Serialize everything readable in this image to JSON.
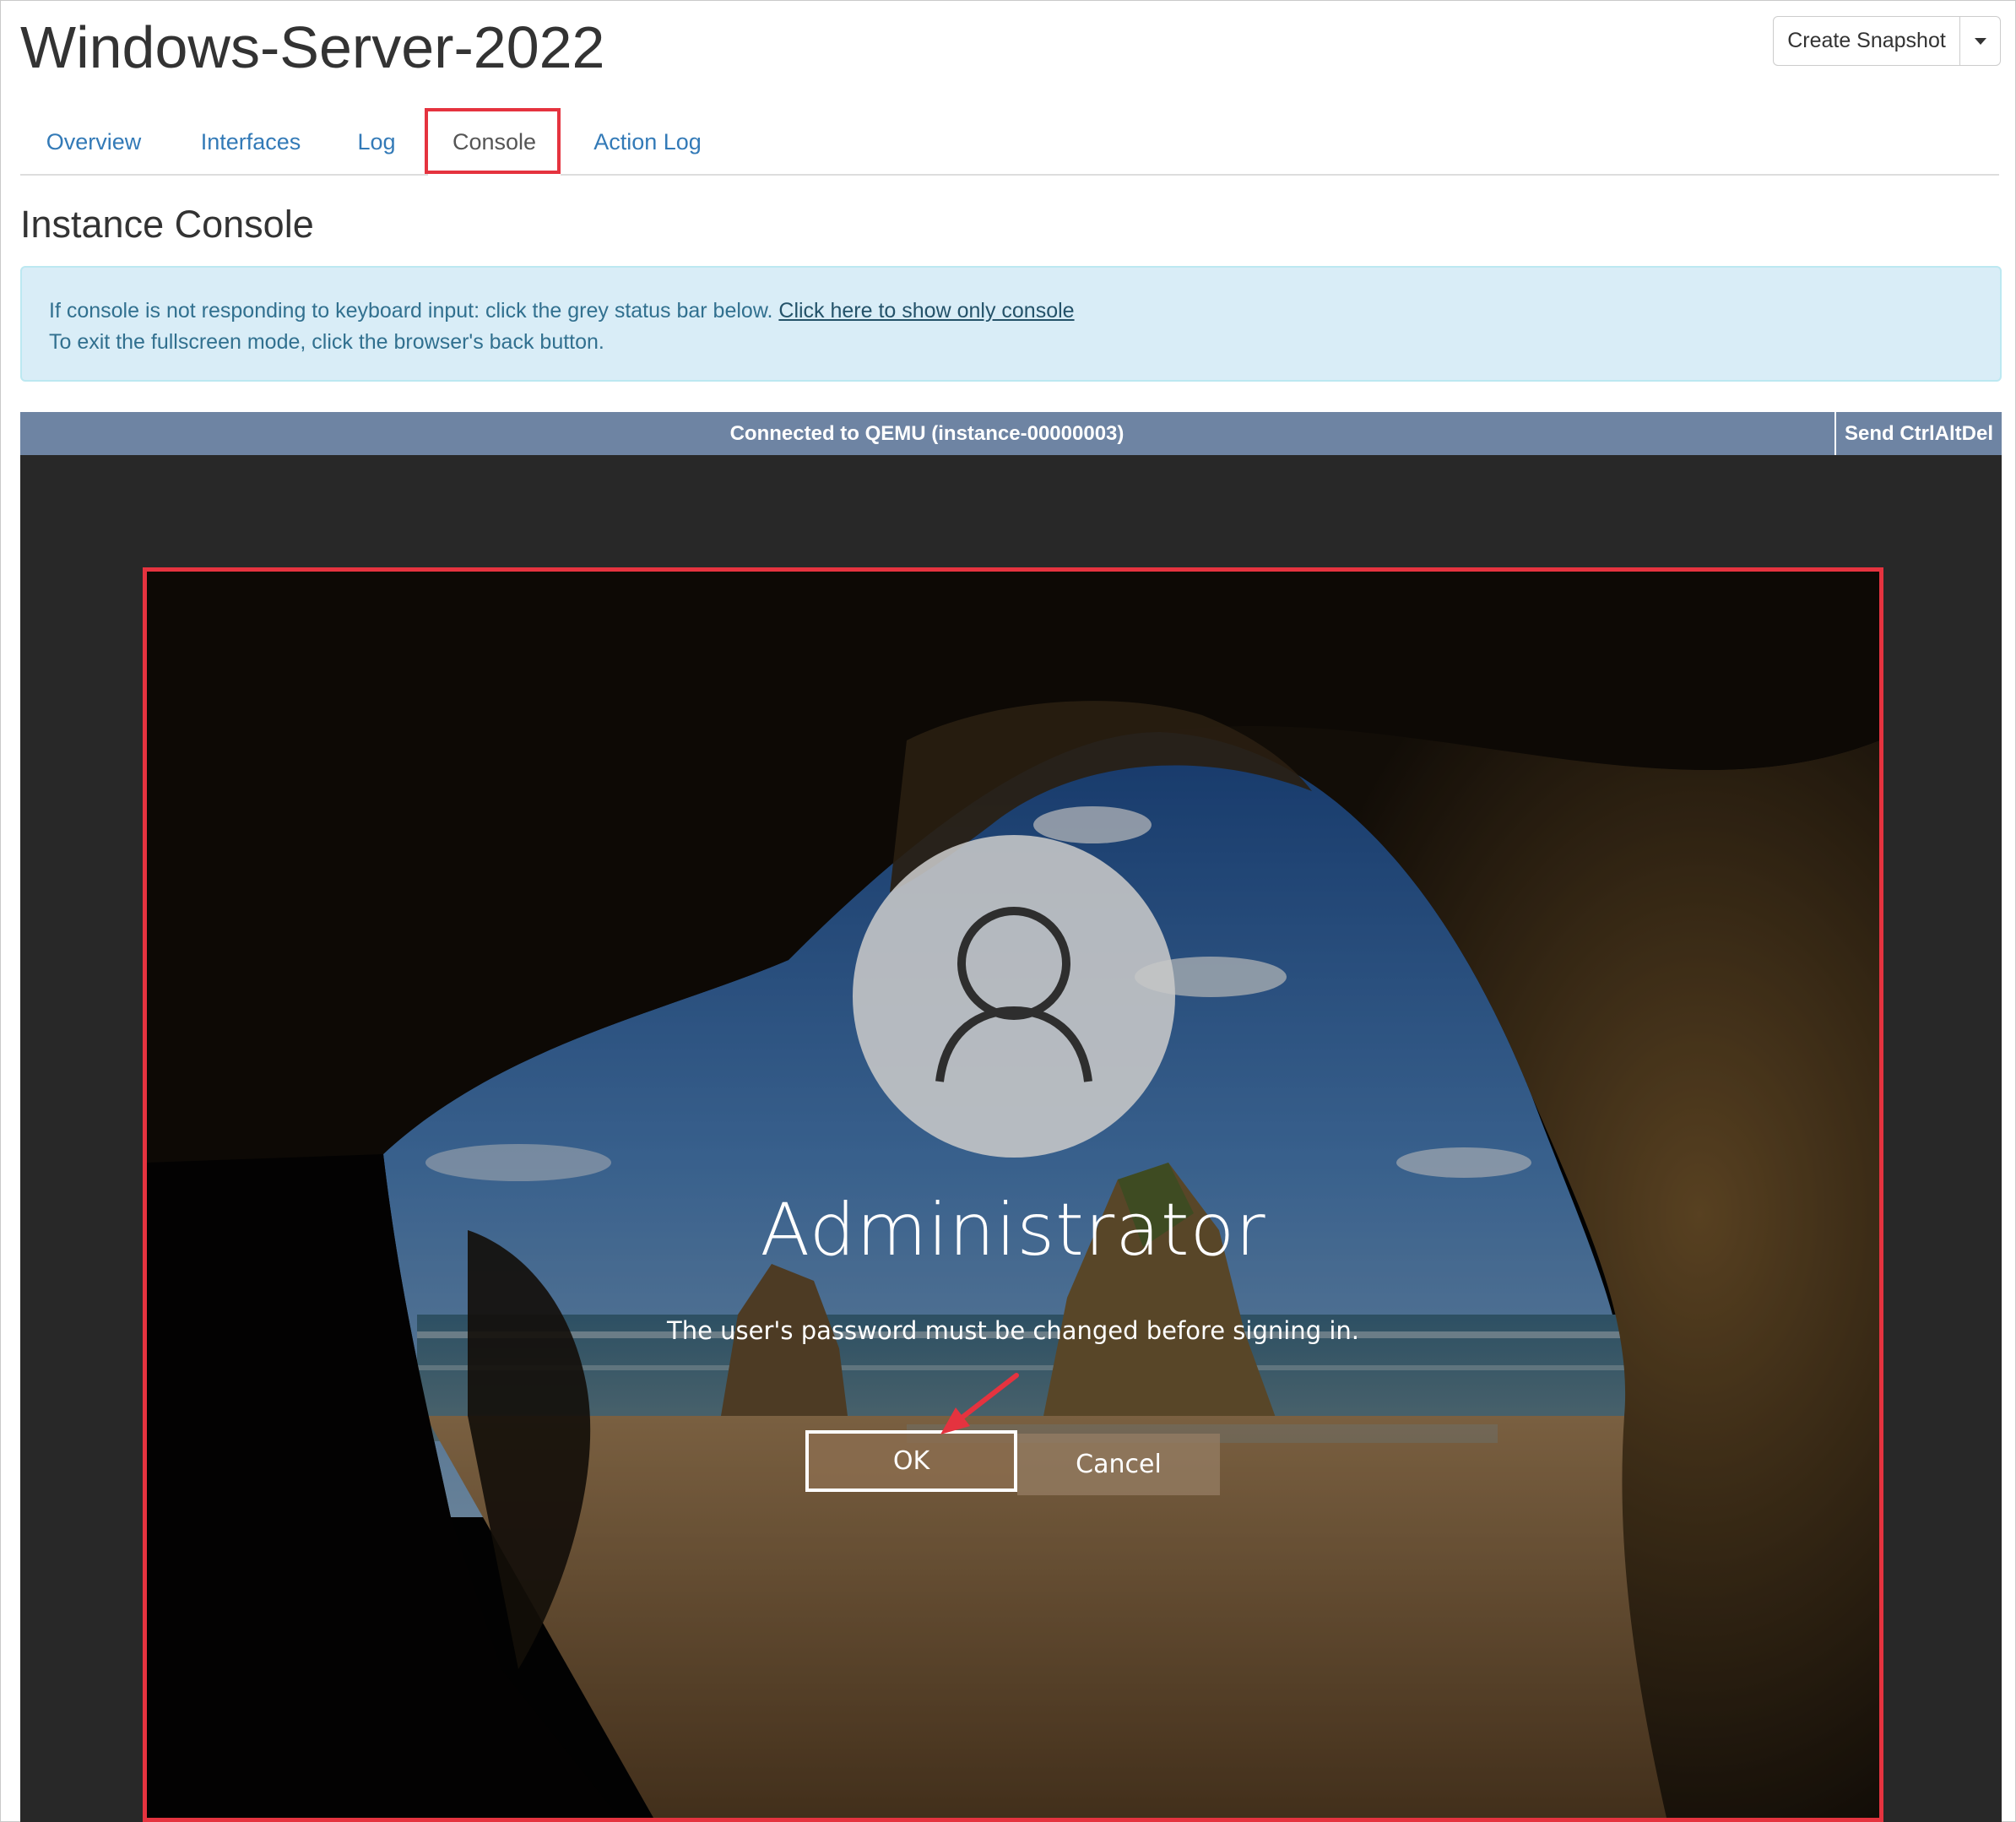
{
  "page": {
    "title": "Windows-Server-2022"
  },
  "actions": {
    "create_snapshot": "Create Snapshot"
  },
  "tabs": [
    {
      "label": "Overview",
      "active": false
    },
    {
      "label": "Interfaces",
      "active": false
    },
    {
      "label": "Log",
      "active": false
    },
    {
      "label": "Console",
      "active": true
    },
    {
      "label": "Action Log",
      "active": false
    }
  ],
  "section": {
    "title": "Instance Console"
  },
  "alert": {
    "line1": "If console is not responding to keyboard input: click the grey status bar below.",
    "link": "Click here to show only console",
    "line2": "To exit the fullscreen mode, click the browser's back button."
  },
  "console": {
    "status": "Connected to QEMU (instance-00000003)",
    "send_ctrl_alt_del": "Send CtrlAltDel"
  },
  "login_screen": {
    "user_name": "Administrator",
    "message": "The user's password must be changed before signing in.",
    "ok_label": "OK",
    "cancel_label": "Cancel"
  },
  "colors": {
    "link": "#337ab7",
    "highlight": "#e5333f",
    "alert_bg": "#d9edf7",
    "alert_text": "#31708f",
    "status_bar": "#6e84a3",
    "console_bg": "#282828"
  },
  "icons": [
    "user-avatar-icon",
    "caret-down-icon",
    "arrow-annotation-icon"
  ]
}
